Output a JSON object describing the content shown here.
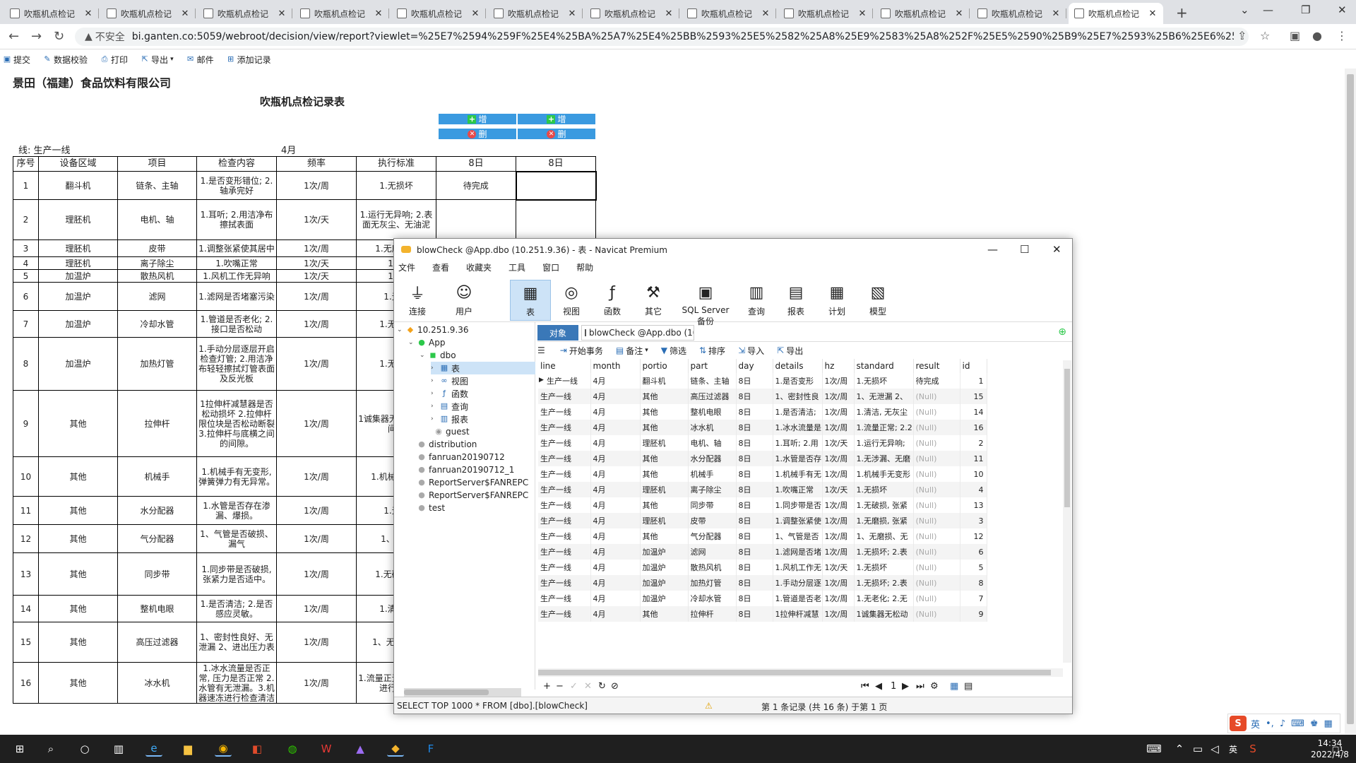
{
  "browser": {
    "tabs": [
      "吹瓶机点检记",
      "吹瓶机点检记",
      "吹瓶机点检记",
      "吹瓶机点检记",
      "吹瓶机点检记",
      "吹瓶机点检记",
      "吹瓶机点检记",
      "吹瓶机点检记",
      "吹瓶机点检记",
      "吹瓶机点检记",
      "吹瓶机点检记",
      "吹瓶机点检记"
    ],
    "active_tab": 11,
    "insecure_label": "不安全",
    "url": "bi.ganten.co:5059/webroot/decision/view/report?viewlet=%25E7%2594%259F%25E4%25BA%25A7%25E4%25BB%2593%25E5%2582%25A8%25E9%2583%25A8%252F%25E5%2590%25B9%25E7%2593%25B6%25E6%259C%25BA..."
  },
  "report_toolbar": {
    "submit": "提交",
    "verify": "数据校验",
    "print": "打印",
    "export": "导出",
    "mail": "邮件",
    "add_record": "添加记录"
  },
  "report": {
    "company": "景田（福建）食品饮料有限公司",
    "title": "吹瓶机点检记录表",
    "add_label": "增",
    "del_label": "删",
    "line_label": "线: 生产一线",
    "month_label": "4月",
    "headers": [
      "序号",
      "设备区域",
      "项目",
      "检查内容",
      "频率",
      "执行标准",
      "8日",
      "8日"
    ],
    "rows": [
      [
        "1",
        "翻斗机",
        "链条、主轴",
        "1.是否变形错位; 2.轴承完好",
        "1次/周",
        "1.无损坏",
        "待完成",
        ""
      ],
      [
        "2",
        "理胚机",
        "电机、轴",
        "1.耳听; 2.用洁净布擦拭表面",
        "1次/天",
        "1.运行无异响; 2.表面无灰尘、无油泥",
        "",
        ""
      ],
      [
        "3",
        "理胚机",
        "皮带",
        "1.调整张紧使其居中",
        "1次/周",
        "1.无磨损态",
        "",
        ""
      ],
      [
        "4",
        "理胚机",
        "离子除尘",
        "1.吹嘴正常",
        "1次/天",
        "1.无",
        "",
        ""
      ],
      [
        "5",
        "加温炉",
        "散热风机",
        "1.风机工作无异响",
        "1次/天",
        "1.无",
        "",
        ""
      ],
      [
        "6",
        "加温炉",
        "滤网",
        "1.滤网是否堵塞污染",
        "1次/周",
        "1.无损",
        "",
        ""
      ],
      [
        "7",
        "加温炉",
        "冷却水管",
        "1.管道是否老化; 2.接口是否松动",
        "1次/周",
        "1.无老化",
        "",
        ""
      ],
      [
        "8",
        "加温炉",
        "加热灯管",
        "1.手动分层逐层开启检查灯管; 2.用洁净布轻轻擦拭灯管表面及反光板",
        "1次/周",
        "1.无损坏",
        "",
        ""
      ],
      [
        "9",
        "其他",
        "拉伸杆",
        "1拉伸杆减慧器是否松动损坏 2.拉伸杆限位块是否松动断裂 3.拉伸杆与底横之间的间隙。",
        "1次/周",
        "1诚集器无损坏松动,间隙",
        "",
        ""
      ],
      [
        "10",
        "其他",
        "机械手",
        "1.机械手有无变形, 弹簧弹力有无异常。",
        "1次/周",
        "1.机械弹簧弹",
        "",
        ""
      ],
      [
        "11",
        "其他",
        "水分配器",
        "1.水管是否存在渗漏、爆损。",
        "1次/周",
        "1.无涉",
        "",
        ""
      ],
      [
        "12",
        "其他",
        "气分配器",
        "1、气管是否破损、漏气",
        "1次/周",
        "1、无磨",
        "",
        ""
      ],
      [
        "13",
        "其他",
        "同步带",
        "1.同步带是否破损, 张紧力是否适中。",
        "1次/周",
        "1.无破损适",
        "",
        ""
      ],
      [
        "14",
        "其他",
        "整机电眼",
        "1.是否清洁; 2.是否感应灵敏。",
        "1次/周",
        "1.清洁油",
        "",
        ""
      ],
      [
        "15",
        "其他",
        "高压过滤器",
        "1、密封性良好、无泄漏 2、进出压力表",
        "1次/周",
        "1、无泄明显",
        "",
        ""
      ],
      [
        "16",
        "其他",
        "冰水机",
        "1.冰水流量是否正常, 压力是否正常 2.水管有无泄漏。3.机器速冻进行检查清洁",
        "1次/周",
        "1.流量正无涉漏污要进行清洁",
        "",
        ""
      ]
    ]
  },
  "navicat": {
    "title": "blowCheck @App.dbo (10.251.9.36) - 表 - Navicat Premium",
    "menu": [
      "文件",
      "查看",
      "收藏夹",
      "工具",
      "窗口",
      "帮助"
    ],
    "ribbon": [
      "连接",
      "用户",
      "表",
      "视图",
      "函数",
      "其它",
      "SQL Server 备份",
      "查询",
      "报表",
      "计划",
      "模型"
    ],
    "tree": {
      "server": "10.251.9.36",
      "db": "App",
      "schema": "dbo",
      "objects": [
        "表",
        "视图",
        "函数",
        "查询",
        "报表"
      ],
      "guest": "guest",
      "others": [
        "distribution",
        "fanruan20190712",
        "fanruan20190712_1",
        "ReportServer$FANREPC",
        "ReportServer$FANREPC",
        "test"
      ]
    },
    "tab_objects": "对象",
    "tab_table": "blowCheck @App.dbo (10.2...",
    "grid_toolbar": {
      "begin": "开始事务",
      "note": "备注",
      "filter": "筛选",
      "sort": "排序",
      "import": "导入",
      "export": "导出"
    },
    "columns": [
      "line",
      "month",
      "portio",
      "part",
      "day",
      "details",
      "hz",
      "standard",
      "result",
      "id"
    ],
    "rows": [
      [
        "生产一线",
        "4月",
        "翻斗机",
        "链条、主轴",
        "8日",
        "1.是否变形",
        "1次/周",
        "1.无损坏",
        "待完成",
        "1"
      ],
      [
        "生产一线",
        "4月",
        "其他",
        "高压过滤器",
        "8日",
        "1、密封性良",
        "1次/周",
        "1、无泄漏 2、",
        "(Null)",
        "15"
      ],
      [
        "生产一线",
        "4月",
        "其他",
        "整机电眼",
        "8日",
        "1.是否清洁;",
        "1次/周",
        "1.清洁, 无灰尘",
        "(Null)",
        "14"
      ],
      [
        "生产一线",
        "4月",
        "其他",
        "冰水机",
        "8日",
        "1.冰水流量是",
        "1次/周",
        "1.流量正常; 2.2",
        "(Null)",
        "16"
      ],
      [
        "生产一线",
        "4月",
        "理胚机",
        "电机、轴",
        "8日",
        "1.耳听; 2.用",
        "1次/天",
        "1.运行无异响;",
        "(Null)",
        "2"
      ],
      [
        "生产一线",
        "4月",
        "其他",
        "水分配器",
        "8日",
        "1.水管是否存",
        "1次/周",
        "1.无涉漏、无磨",
        "(Null)",
        "11"
      ],
      [
        "生产一线",
        "4月",
        "其他",
        "机械手",
        "8日",
        "1.机械手有无",
        "1次/周",
        "1.机械手无变形",
        "(Null)",
        "10"
      ],
      [
        "生产一线",
        "4月",
        "理胚机",
        "离子除尘",
        "8日",
        "1.吹嘴正常",
        "1次/天",
        "1.无损坏",
        "(Null)",
        "4"
      ],
      [
        "生产一线",
        "4月",
        "其他",
        "同步带",
        "8日",
        "1.同步带是否",
        "1次/周",
        "1.无破损, 张紧",
        "(Null)",
        "13"
      ],
      [
        "生产一线",
        "4月",
        "理胚机",
        "皮带",
        "8日",
        "1.调整张紧使",
        "1次/周",
        "1.无磨损, 张紧",
        "(Null)",
        "3"
      ],
      [
        "生产一线",
        "4月",
        "其他",
        "气分配器",
        "8日",
        "1、气管是否",
        "1次/周",
        "1、无磨损、无",
        "(Null)",
        "12"
      ],
      [
        "生产一线",
        "4月",
        "加温炉",
        "滤网",
        "8日",
        "1.滤网是否堵",
        "1次/周",
        "1.无损坏; 2.表",
        "(Null)",
        "6"
      ],
      [
        "生产一线",
        "4月",
        "加温炉",
        "散热风机",
        "8日",
        "1.风机工作无",
        "1次/天",
        "1.无损坏",
        "(Null)",
        "5"
      ],
      [
        "生产一线",
        "4月",
        "加温炉",
        "加热灯管",
        "8日",
        "1.手动分层逐",
        "1次/周",
        "1.无损坏; 2.表",
        "(Null)",
        "8"
      ],
      [
        "生产一线",
        "4月",
        "加温炉",
        "冷却水管",
        "8日",
        "1.管道是否老",
        "1次/周",
        "1.无老化; 2.无",
        "(Null)",
        "7"
      ],
      [
        "生产一线",
        "4月",
        "其他",
        "拉伸杆",
        "8日",
        "1拉伸杆减慧",
        "1次/周",
        "1诚集器无松动",
        "(Null)",
        "9"
      ]
    ],
    "page": "1",
    "sql": "SELECT TOP 1000 * FROM [dbo].[blowCheck]",
    "record_info": "第 1 条记录 (共 16 条) 于第 1 页"
  },
  "ime": {
    "lang": "英"
  },
  "clock": {
    "time": "14:34",
    "date": "2022/4/8"
  },
  "tray": {
    "ime": "英",
    "notif_count": "1"
  }
}
